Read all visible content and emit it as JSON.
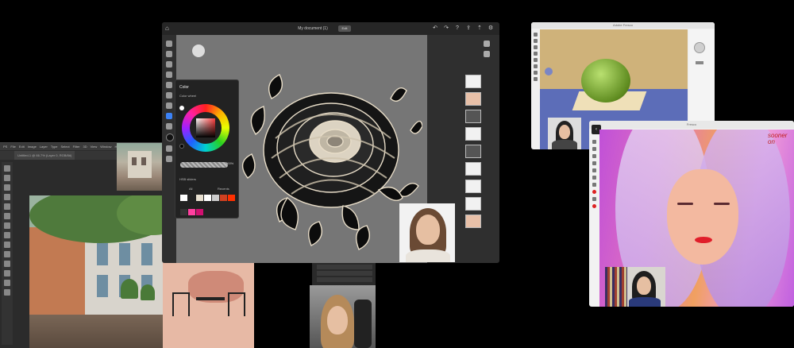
{
  "photoshop": {
    "menu": [
      "PS",
      "File",
      "Edit",
      "Image",
      "Layer",
      "Type",
      "Select",
      "Filter",
      "3D",
      "View",
      "Window",
      "Help"
    ],
    "tab_label": "Untitled-1 @ 66.7% (Layer 0, RGB/8#)"
  },
  "fresco": {
    "title": "My document (1)",
    "save_label": "Edit",
    "top_icons": [
      "undo-icon",
      "redo-icon",
      "help-icon",
      "share-icon",
      "export-icon",
      "settings-icon",
      "fullscreen-icon"
    ],
    "color_panel": {
      "title": "Color",
      "wheel_label": "Color wheel",
      "opacity": "100%",
      "hsb_label": "HSB sliders",
      "tab_all": "All",
      "tab_recents": "Recents",
      "swatches": [
        "#ffffff",
        "#222222",
        "#e8e0d0",
        "#ffffff",
        "#cccccc",
        "#d04020",
        "#ff3000",
        "#333333",
        "#ff40a0",
        "#d01070"
      ]
    }
  },
  "apple_window": {
    "title": "Adobe Fresco"
  },
  "portrait_window": {
    "title": "Fresco",
    "signature": "sooner on"
  },
  "colors": {
    "accent": "#3b82f6",
    "lips": "#e01e2a"
  }
}
